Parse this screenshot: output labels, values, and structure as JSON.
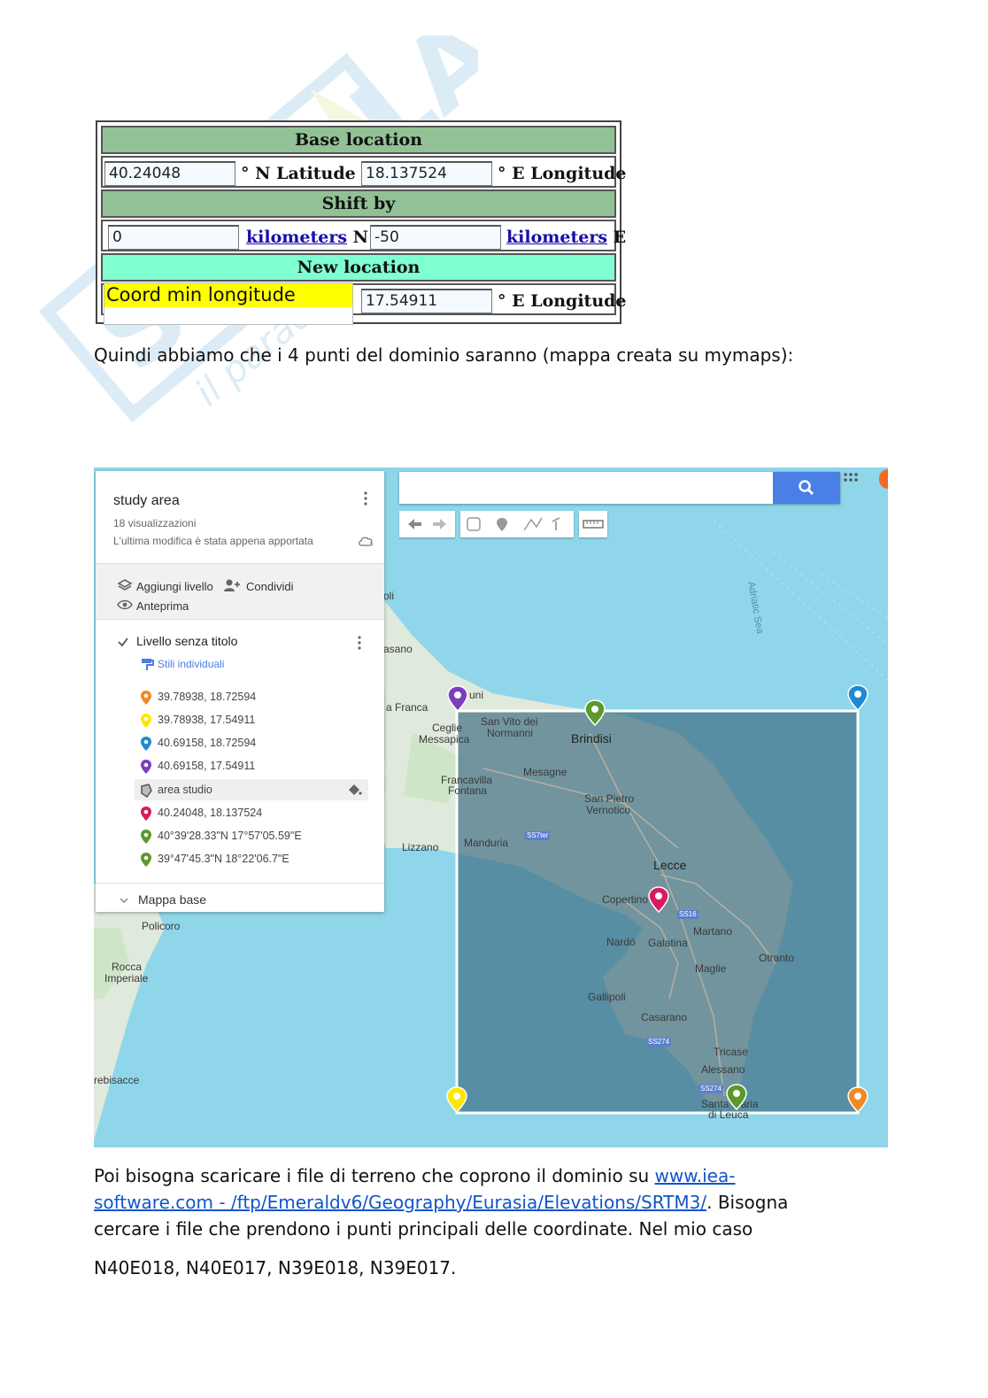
{
  "calculator": {
    "base_header": "Base location",
    "base_lat_value": "40.24048",
    "base_lat_label": "° N Latitude",
    "base_lon_value": "18.137524",
    "base_lon_label": "° E Longitude",
    "shift_header": "Shift by",
    "shift_n_value": "0",
    "shift_n_link": "kilometers",
    "shift_n_suffix": "N",
    "shift_e_value": "-50",
    "shift_e_link": "kilometers",
    "shift_e_suffix": "E",
    "new_header": "New location",
    "new_lon_value": "17.54911",
    "new_lon_label": "° E Longitude",
    "tooltip_text": "Coord min longitude"
  },
  "text": {
    "para1": "Quindi abbiamo che i 4 punti del dominio saranno (mappa creata su mymaps):",
    "para2_a": "Poi bisogna scaricare i file di terreno che coprono il dominio su ",
    "link_line1": "www.iea-",
    "link_line2": "software.com - /ftp/Emeraldv6/Geography/Eurasia/Elevations/SRTM3/",
    "para2_b": ". Bisogna",
    "para2_c": "cercare i file che prendono i punti principali delle coordinate. Nel mio caso",
    "para3": "N40E018, N40E017, N39E018, N39E017."
  },
  "map": {
    "title": "study area",
    "views": "18 visualizzazioni",
    "modified": "L'ultima modifica è stata appena apportata",
    "add_layer": "Aggiungi livello",
    "share": "Condividi",
    "preview": "Anteprima",
    "layer_name": "Livello senza titolo",
    "styles": "Stili individuali",
    "base_map": "Mappa base",
    "items": [
      {
        "label": "39.78938, 18.72594",
        "color": "#f08a24",
        "icon": "pin-icon"
      },
      {
        "label": "39.78938, 17.54911",
        "color": "#ffe600",
        "icon": "pin-icon"
      },
      {
        "label": "40.69158, 18.72594",
        "color": "#1f8ad1",
        "icon": "pin-icon"
      },
      {
        "label": "40.69158, 17.54911",
        "color": "#7b3fbe",
        "icon": "pin-icon"
      },
      {
        "label": "area studio",
        "color": "#555555",
        "icon": "polygon-icon"
      },
      {
        "label": "40.24048, 18.137524",
        "color": "#d81b60",
        "icon": "pin-icon"
      },
      {
        "label": "40°39'28.33\"N 17°57'05.59\"E",
        "color": "#5b9a2a",
        "icon": "pin-icon"
      },
      {
        "label": "39°47'45.3\"N 18°22'06.7\"E",
        "color": "#5b9a2a",
        "icon": "pin-icon"
      }
    ],
    "places": {
      "brindisi": "Brindisi",
      "lecce": "Lecce",
      "san_vito": "San Vito dei",
      "san_vito2": "Normanni",
      "mesagne": "Mesagne",
      "san_pietro": "San Pietro",
      "san_pietro2": "Vernotico",
      "francavilla": "Francavilla",
      "francavilla2": "Fontana",
      "manduria": "Manduria",
      "lizzano": "Lizzano",
      "copertino": "Copertino",
      "nardo": "Nardò",
      "galatina": "Galatina",
      "martano": "Martano",
      "otranto": "Otranto",
      "maglie": "Maglie",
      "gallipoli": "Gallipoli",
      "casarano": "Casarano",
      "tricase": "Tricase",
      "alessano": "Alessano",
      "santa_maria": "Santa Maria",
      "di_leuca": "di Leuca",
      "policoro": "Policoro",
      "rocca": "Rocca",
      "imperiale": "Imperiale",
      "trebisacce": "rebisacce",
      "ceglie": "Ceglie",
      "messapica": "Messapica",
      "ostuni": "uni",
      "franca": "a Franca",
      "fasano": "asano",
      "oli": "oli",
      "adriatic": "Adriatic Sea"
    },
    "roads": [
      "SS7ter",
      "SS16",
      "SS274",
      "SS274"
    ]
  }
}
